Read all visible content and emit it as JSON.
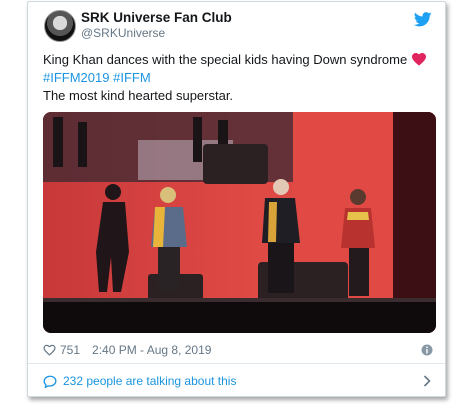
{
  "tweet": {
    "display_name": "SRK Universe Fan Club",
    "handle": "@SRKUniverse",
    "text_line1": "King Khan dances with the special kids having Down syndrome",
    "hashtags": [
      "#IFFM2019",
      "#IFFM"
    ],
    "text_line3": "The most kind hearted superstar.",
    "likes": "751",
    "timestamp": "2:40 PM - Aug 8, 2019",
    "talking": "232 people are talking about this"
  },
  "icons": {
    "brand": "twitter-bird-icon",
    "emoji": "red-heart-icon",
    "like": "heart-outline-icon",
    "info": "info-icon",
    "comments": "speech-bubble-icon",
    "more": "chevron-right-icon"
  },
  "colors": {
    "link": "#1b95e0",
    "secondary_text": "#657786",
    "emoji_heart": "#e0245e"
  }
}
